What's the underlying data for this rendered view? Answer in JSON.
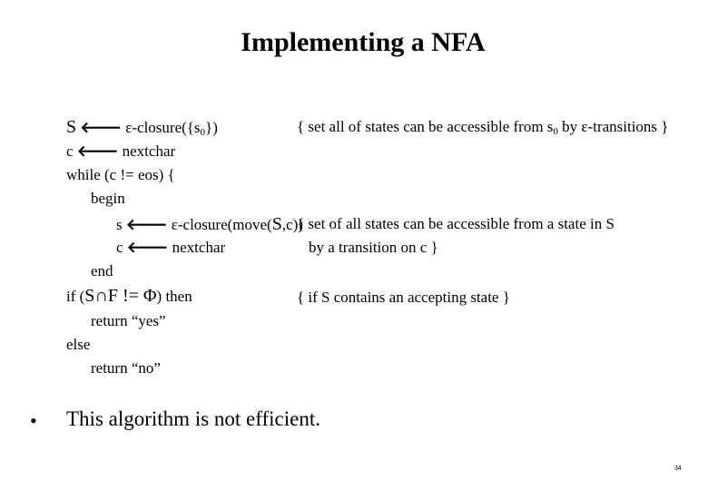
{
  "title": "Implementing a NFA",
  "code": {
    "l1_var": "S",
    "l1_expr_pre": "ε-closure({s",
    "l1_sub": "0",
    "l1_expr_post": "})",
    "l1_comment_pre": "{ set all of states can be accessible from s",
    "l1_comment_sub": "0",
    "l1_comment_post": " by ε-transitions }",
    "l2_var": "c",
    "l2_expr": "nextchar",
    "l3": "while (c != eos) {",
    "l4": "begin",
    "l5_var": "s",
    "l5_expr_pre": "ε-closure(move(",
    "l5_S": "S",
    "l5_expr_post": ",c))",
    "l5_comment": "{ set of all states can be accessible from a state in S",
    "l6_var": "c",
    "l6_expr": "nextchar",
    "l6_comment": "by a transition on c }",
    "l7": "end",
    "l8_pre": "if (",
    "l8_cond": "S∩F != Φ",
    "l8_post": ") then",
    "l8_comment": "{ if S contains an accepting state }",
    "l9": "return “yes”",
    "l10": "else",
    "l11": "return “no”",
    "arrow": "🡐"
  },
  "bullet": {
    "symbol": "•",
    "text": "This algorithm is not efficient."
  },
  "page_number": "34"
}
